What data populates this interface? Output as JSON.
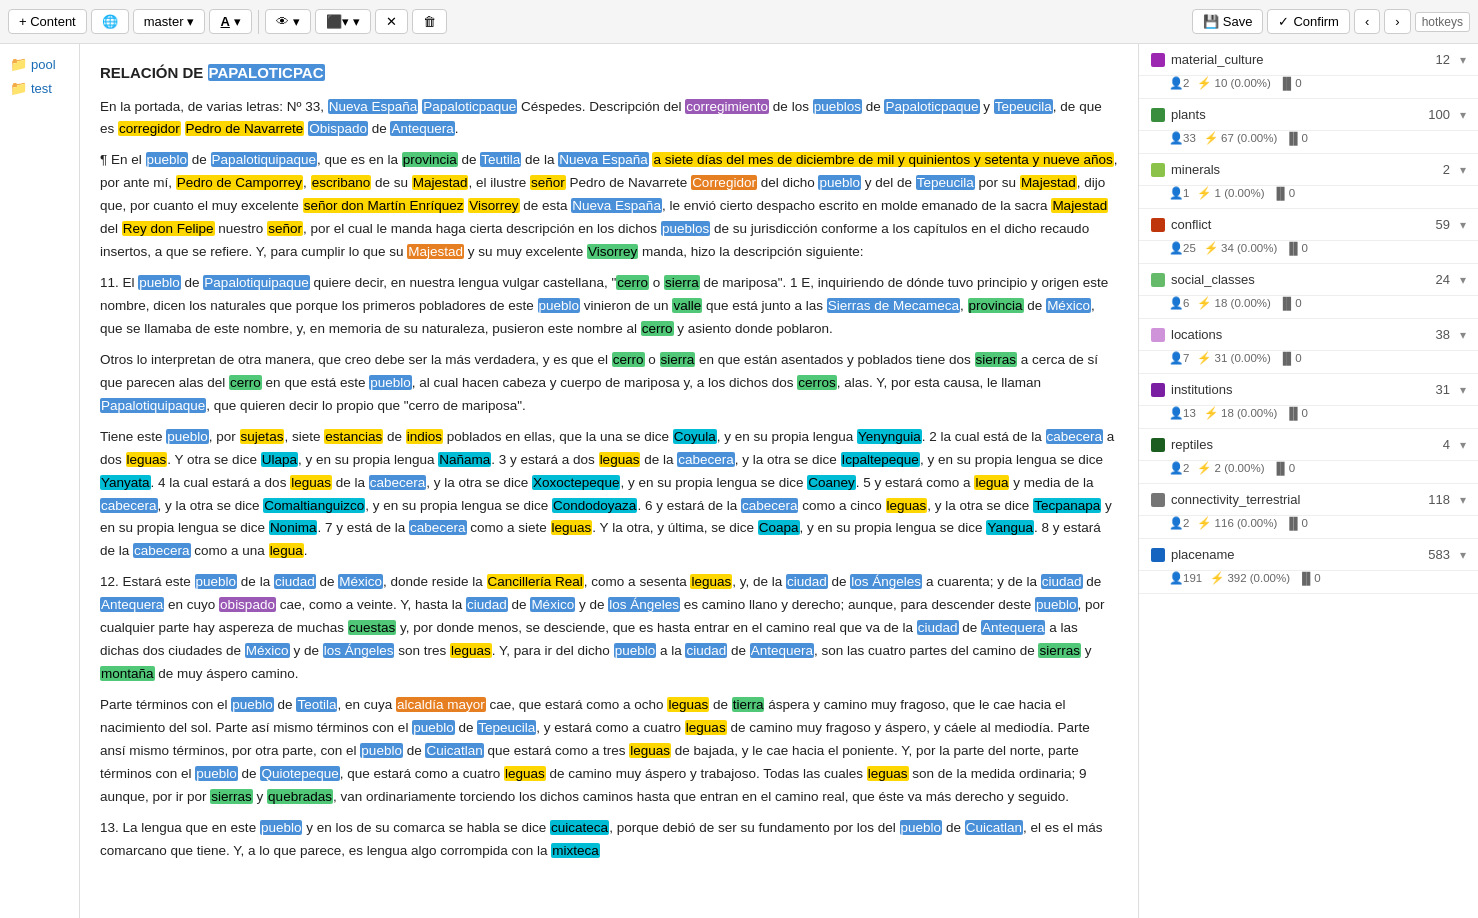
{
  "toolbar": {
    "content_btn": "+ Content",
    "globe_icon": "🌐",
    "branch_btn": "master",
    "font_btn": "A",
    "eye_icon": "👁",
    "align_icon": "≡",
    "close_icon": "✕",
    "delete_icon": "🗑",
    "save_btn": "Save",
    "confirm_btn": "Confirm",
    "prev_icon": "‹",
    "next_icon": "›",
    "hotkeys_label": "hotkeys"
  },
  "sidebar": {
    "items": [
      {
        "label": "pool",
        "icon": "📁"
      },
      {
        "label": "test",
        "icon": "📁"
      }
    ]
  },
  "right_panel": {
    "categories": [
      {
        "name": "material_culture",
        "color": "#9c27b0",
        "count": 12,
        "users": 2,
        "annotations": "10 (0.00%)",
        "bar": 0
      },
      {
        "name": "plants",
        "color": "#388e3c",
        "count": 100,
        "users": 33,
        "annotations": "67 (0.00%)",
        "bar": 0
      },
      {
        "name": "minerals",
        "color": "#8bc34a",
        "count": 2,
        "users": 1,
        "annotations": "1 (0.00%)",
        "bar": 0
      },
      {
        "name": "conflict",
        "color": "#bf360c",
        "count": 59,
        "users": 25,
        "annotations": "34 (0.00%)",
        "bar": 0
      },
      {
        "name": "social_classes",
        "color": "#66bb6a",
        "count": 24,
        "users": 6,
        "annotations": "18 (0.00%)",
        "bar": 0
      },
      {
        "name": "locations",
        "color": "#ce93d8",
        "count": 38,
        "users": 7,
        "annotations": "31 (0.00%)",
        "bar": 0
      },
      {
        "name": "institutions",
        "color": "#7b1fa2",
        "count": 31,
        "users": 13,
        "annotations": "18 (0.00%)",
        "bar": 0
      },
      {
        "name": "reptiles",
        "color": "#1b5e20",
        "count": 4,
        "users": 2,
        "annotations": "2 (0.00%)",
        "bar": 0
      },
      {
        "name": "connectivity_terrestrial",
        "color": "#757575",
        "count": 118,
        "users": 2,
        "annotations": "116 (0.00%)",
        "bar": 0
      },
      {
        "name": "placename",
        "color": "#1565c0",
        "count": 583,
        "users": 191,
        "annotations": "392 (0.00%)",
        "bar": 0
      }
    ]
  }
}
